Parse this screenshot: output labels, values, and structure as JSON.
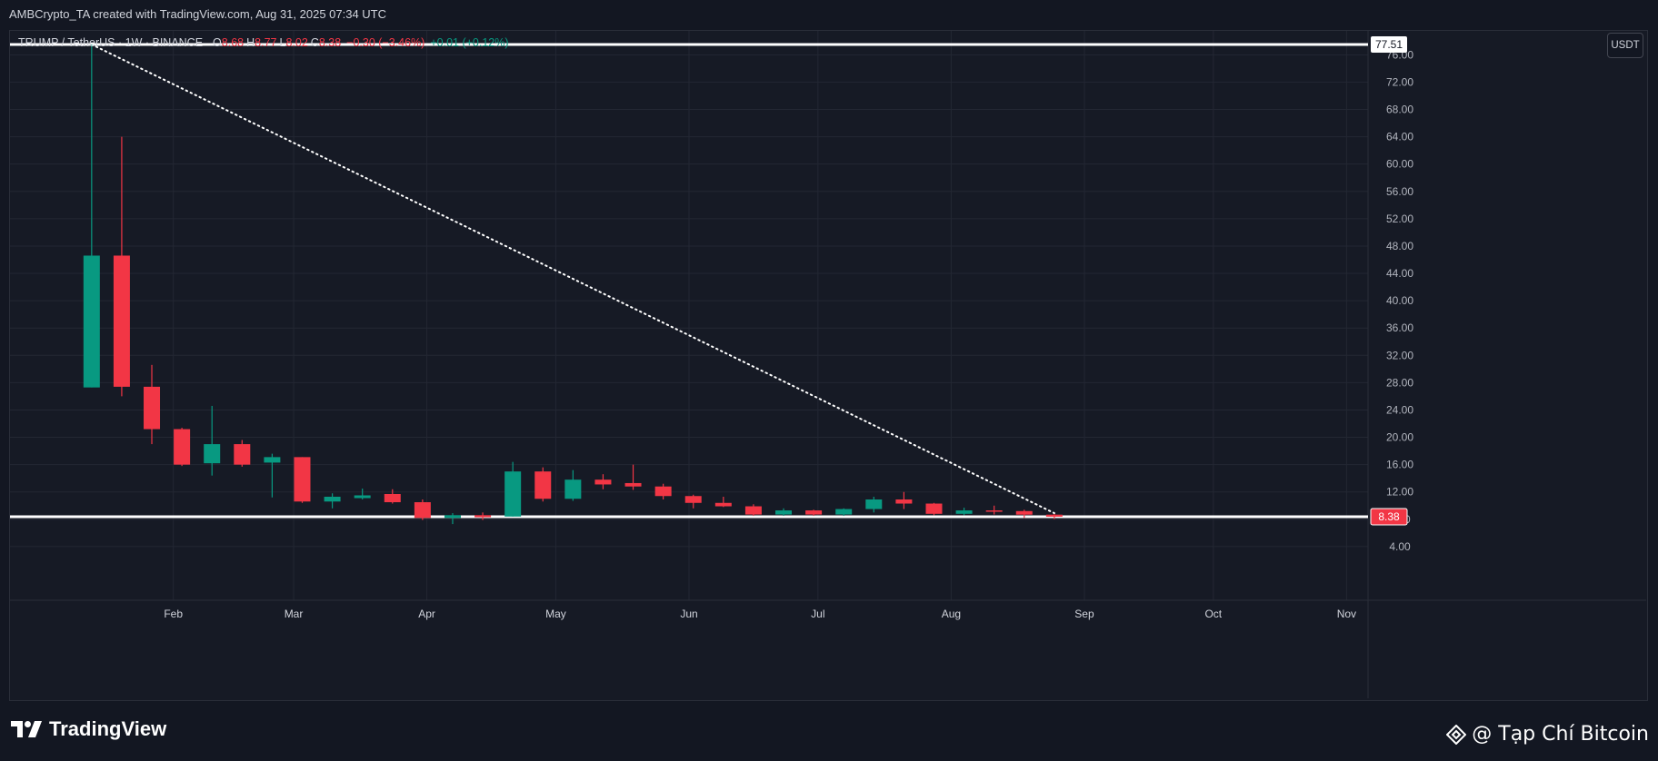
{
  "header": {
    "credit": "AMBCrypto_TA created with TradingView.com, Aug 31, 2025 07:34 UTC"
  },
  "legend": {
    "symbol": "TRUMP / TetherUS · 1W · BINANCE",
    "open_label": "O",
    "open_value": "8.68",
    "high_label": "H",
    "high_value": "8.77",
    "low_label": "L",
    "low_value": "8.02",
    "close_label": "C",
    "close_value": "8.38",
    "change": "−0.30 (−3.46%)",
    "change2": "+0.01 (+0.12%)"
  },
  "currency_button": "USDT",
  "footer": {
    "brand": "TradingView",
    "watermark": "@ Tạp Chí Bitcoin"
  },
  "colors": {
    "up": "#089981",
    "down": "#f23645",
    "background": "#161a25",
    "grid": "#232733",
    "level_line": "#ffffff"
  },
  "chart_data": {
    "type": "candlestick",
    "ylim": [
      0,
      79.5
    ],
    "y_ticks": [
      "4.00",
      "8.00",
      "12.00",
      "16.00",
      "20.00",
      "24.00",
      "28.00",
      "32.00",
      "36.00",
      "40.00",
      "44.00",
      "48.00",
      "52.00",
      "56.00",
      "60.00",
      "64.00",
      "68.00",
      "72.00",
      "76.00"
    ],
    "x_labels": [
      {
        "label": "Feb",
        "date": "2025-02-01"
      },
      {
        "label": "Mar",
        "date": "2025-03-01"
      },
      {
        "label": "Apr",
        "date": "2025-04-01"
      },
      {
        "label": "May",
        "date": "2025-05-01"
      },
      {
        "label": "Jun",
        "date": "2025-06-01"
      },
      {
        "label": "Jul",
        "date": "2025-07-01"
      },
      {
        "label": "Aug",
        "date": "2025-08-01"
      },
      {
        "label": "Sep",
        "date": "2025-09-01"
      },
      {
        "label": "Oct",
        "date": "2025-10-01"
      },
      {
        "label": "Nov",
        "date": "2025-11-01"
      }
    ],
    "date_range": [
      "2024-12-25",
      "2025-11-06"
    ],
    "candles": [
      {
        "date": "2025-01-13",
        "o": 27.3,
        "h": 77.51,
        "l": 27.3,
        "c": 46.6
      },
      {
        "date": "2025-01-20",
        "o": 46.6,
        "h": 64.0,
        "l": 26.0,
        "c": 27.4
      },
      {
        "date": "2025-01-27",
        "o": 27.4,
        "h": 30.6,
        "l": 19.0,
        "c": 21.2
      },
      {
        "date": "2025-02-03",
        "o": 21.2,
        "h": 21.4,
        "l": 15.8,
        "c": 16.0
      },
      {
        "date": "2025-02-10",
        "o": 16.2,
        "h": 24.6,
        "l": 14.4,
        "c": 19.0
      },
      {
        "date": "2025-02-17",
        "o": 19.0,
        "h": 19.6,
        "l": 15.7,
        "c": 16.0
      },
      {
        "date": "2025-02-24",
        "o": 16.3,
        "h": 17.6,
        "l": 11.2,
        "c": 17.1
      },
      {
        "date": "2025-03-03",
        "o": 17.1,
        "h": 17.1,
        "l": 10.4,
        "c": 10.6
      },
      {
        "date": "2025-03-10",
        "o": 10.6,
        "h": 11.8,
        "l": 9.6,
        "c": 11.3
      },
      {
        "date": "2025-03-17",
        "o": 11.1,
        "h": 12.5,
        "l": 10.9,
        "c": 11.5
      },
      {
        "date": "2025-03-24",
        "o": 11.7,
        "h": 12.4,
        "l": 10.3,
        "c": 10.5
      },
      {
        "date": "2025-03-31",
        "o": 10.5,
        "h": 10.9,
        "l": 7.9,
        "c": 8.2
      },
      {
        "date": "2025-04-07",
        "o": 8.2,
        "h": 8.9,
        "l": 7.3,
        "c": 8.6
      },
      {
        "date": "2025-04-14",
        "o": 8.6,
        "h": 9.0,
        "l": 7.9,
        "c": 8.3
      },
      {
        "date": "2025-04-21",
        "o": 8.4,
        "h": 16.4,
        "l": 8.4,
        "c": 15.0
      },
      {
        "date": "2025-04-28",
        "o": 15.0,
        "h": 15.6,
        "l": 10.6,
        "c": 11.0
      },
      {
        "date": "2025-05-05",
        "o": 11.0,
        "h": 15.2,
        "l": 10.7,
        "c": 13.8
      },
      {
        "date": "2025-05-12",
        "o": 13.8,
        "h": 14.6,
        "l": 12.4,
        "c": 13.1
      },
      {
        "date": "2025-05-19",
        "o": 13.3,
        "h": 16.0,
        "l": 12.3,
        "c": 12.8
      },
      {
        "date": "2025-05-26",
        "o": 12.8,
        "h": 13.2,
        "l": 10.9,
        "c": 11.4
      },
      {
        "date": "2025-06-02",
        "o": 11.4,
        "h": 11.6,
        "l": 9.6,
        "c": 10.4
      },
      {
        "date": "2025-06-09",
        "o": 10.4,
        "h": 11.3,
        "l": 9.8,
        "c": 9.9
      },
      {
        "date": "2025-06-16",
        "o": 9.9,
        "h": 10.2,
        "l": 8.5,
        "c": 8.7
      },
      {
        "date": "2025-06-23",
        "o": 8.7,
        "h": 9.6,
        "l": 8.5,
        "c": 9.3
      },
      {
        "date": "2025-06-30",
        "o": 9.3,
        "h": 9.4,
        "l": 8.5,
        "c": 8.7
      },
      {
        "date": "2025-07-07",
        "o": 8.7,
        "h": 9.6,
        "l": 8.5,
        "c": 9.5
      },
      {
        "date": "2025-07-14",
        "o": 9.5,
        "h": 11.3,
        "l": 9.0,
        "c": 10.9
      },
      {
        "date": "2025-07-21",
        "o": 10.9,
        "h": 12.0,
        "l": 9.5,
        "c": 10.3
      },
      {
        "date": "2025-07-28",
        "o": 10.3,
        "h": 10.4,
        "l": 8.6,
        "c": 8.8
      },
      {
        "date": "2025-08-04",
        "o": 8.8,
        "h": 9.7,
        "l": 8.6,
        "c": 9.3
      },
      {
        "date": "2025-08-11",
        "o": 9.3,
        "h": 10.0,
        "l": 8.7,
        "c": 9.2
      },
      {
        "date": "2025-08-18",
        "o": 9.2,
        "h": 9.4,
        "l": 8.2,
        "c": 8.68
      },
      {
        "date": "2025-08-25",
        "o": 8.68,
        "h": 8.77,
        "l": 8.02,
        "c": 8.38
      }
    ],
    "levels": [
      {
        "price": 77.51,
        "label": "77.51"
      },
      {
        "price": 8.38,
        "label": "8.38"
      }
    ],
    "trendline": {
      "from_date": "2025-01-13",
      "from_price": 77.51,
      "to_date": "2025-08-25",
      "to_price": 8.9
    }
  }
}
